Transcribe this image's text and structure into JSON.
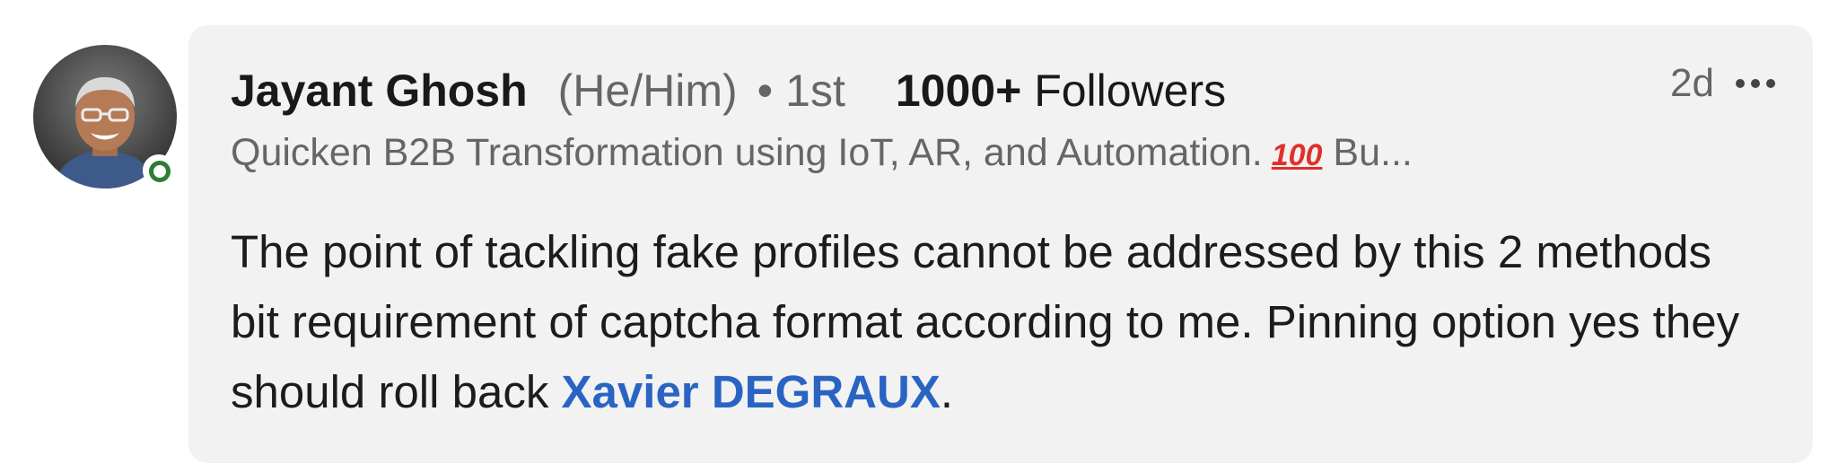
{
  "comment": {
    "author": {
      "name": "Jayant Ghosh",
      "pronouns": "(He/Him)",
      "bullet": "•",
      "degree": "1st",
      "followers_count": "1000+",
      "followers_label": "Followers",
      "headline": "Quicken B2B Transformation using IoT, AR, and Automation.",
      "headline_emoji": "100",
      "headline_tail": "Bu..."
    },
    "timestamp": "2d",
    "body": {
      "line_text_before_mention": "The point of tackling fake profiles cannot be addressed by this 2 methods bit requirement of captcha format according to me. Pinning option yes they should roll back ",
      "mention": "Xavier DEGRAUX",
      "after_mention": "."
    }
  },
  "icons": {
    "more": "more-horizontal-icon",
    "status": "online-status-icon"
  },
  "colors": {
    "card_bg": "#f2f2f2",
    "mention": "#2a64c3",
    "status_ring": "#2e7d32",
    "secondary_text": "#666666"
  }
}
